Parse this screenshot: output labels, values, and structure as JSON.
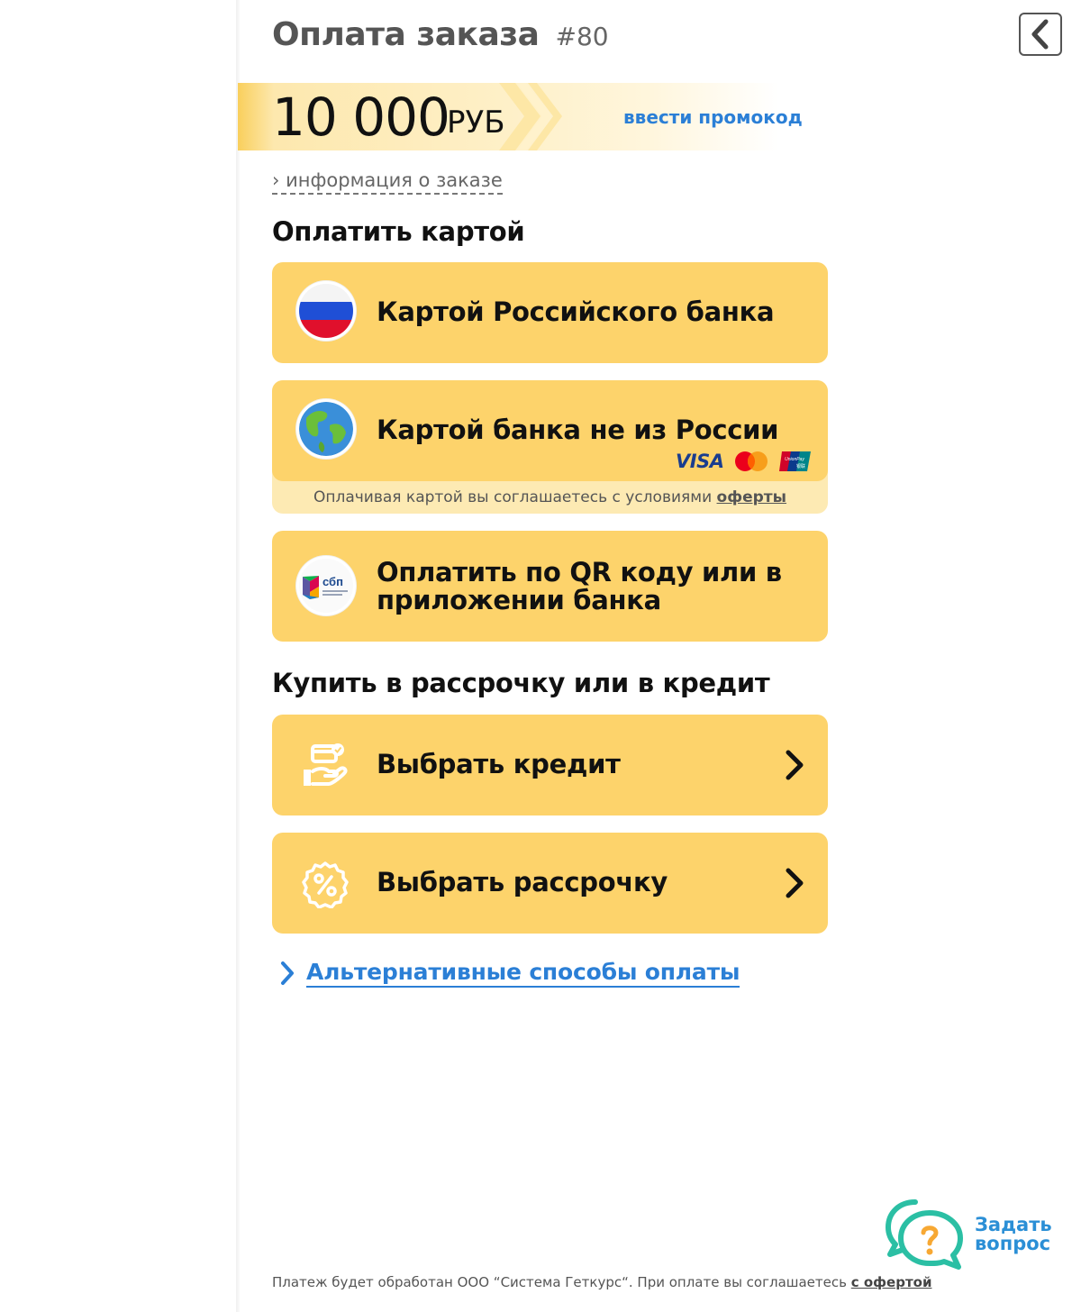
{
  "header": {
    "title": "Оплата заказа",
    "order_number": "#80",
    "back_icon": "chevron-left-icon"
  },
  "price": {
    "amount": "10 000",
    "currency": "РУБ",
    "promo_link": "ввести промокод"
  },
  "order_info_link": "› информация о заказе",
  "card_section": {
    "title": "Оплатить картой",
    "options": [
      {
        "label": "Картой Российского банка",
        "icon": "russia-flag-icon"
      },
      {
        "label": "Картой банка не из России",
        "icon": "globe-icon",
        "brands": [
          "VISA",
          "mastercard",
          "UnionPay"
        ]
      },
      {
        "label_line1": "Оплатить по QR коду или в",
        "label_line2": "приложении банка",
        "icon": "sbp-logo-icon"
      }
    ],
    "terms_prefix": "Оплачивая картой вы соглашаетесь с условиями ",
    "terms_link": "оферты"
  },
  "credit_section": {
    "title": "Купить в рассрочку или в кредит",
    "options": [
      {
        "label": "Выбрать кредит",
        "icon": "hand-card-icon"
      },
      {
        "label": "Выбрать рассрочку",
        "icon": "percent-badge-icon"
      }
    ]
  },
  "alt_payment_link": "Альтернативные способы оплаты",
  "ask_question": {
    "line1": "Задать",
    "line2": "вопрос"
  },
  "footer": {
    "text": "Платеж будет обработан ООО “Система Геткурс“. При оплате вы соглашаетесь ",
    "link": "с офертой"
  },
  "colors": {
    "card_bg": "#fdd36b",
    "link": "#2b7fd6",
    "chat_teal": "#2bbfa4"
  }
}
